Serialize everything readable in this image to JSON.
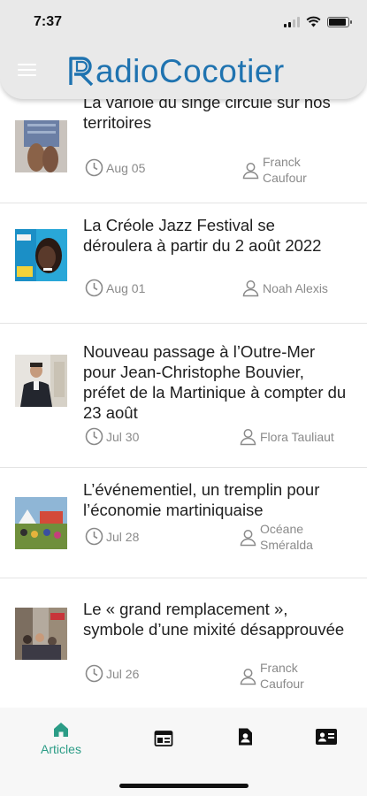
{
  "status_bar": {
    "time": "7:37",
    "battery_level": 0.9,
    "signal_bars": 2
  },
  "header": {
    "brand": "adioCocotier",
    "brand_accent": "#1f73b0",
    "menu_icon": "hamburger-icon",
    "logo_mark": "R"
  },
  "articles": [
    {
      "title": "La variole du singe circule sur nos territoires",
      "date": "Aug 05",
      "author": "Franck Caufour"
    },
    {
      "title": "La Créole Jazz Festival se déroulera à partir du 2 août 2022",
      "date": "Aug 01",
      "author": "Noah Alexis"
    },
    {
      "title": "Nouveau passage à l’Outre-Mer pour Jean-Christophe Bouvier, préfet de la Martinique à compter du 23 août",
      "date": "Jul 30",
      "author": "Flora Tauliaut"
    },
    {
      "title": "L’événementiel, un tremplin pour l’économie martiniquaise",
      "date": "Jul 28",
      "author": "Océane Sméralda"
    },
    {
      "title": "Le « grand remplacement », symbole d’une mixité désapprouvée",
      "date": "Jul 26",
      "author": "Franck Caufour"
    }
  ],
  "tabs": [
    {
      "label": "Articles",
      "icon": "home-icon",
      "active": true
    },
    {
      "label": "",
      "icon": "newspaper-icon",
      "active": false
    },
    {
      "label": "",
      "icon": "contact-page-icon",
      "active": false
    },
    {
      "label": "",
      "icon": "contact-card-icon",
      "active": false
    }
  ],
  "colors": {
    "tab_active": "#2b9c86",
    "meta_text": "#8a8a8a",
    "header_bg": "#e9e9e9"
  }
}
